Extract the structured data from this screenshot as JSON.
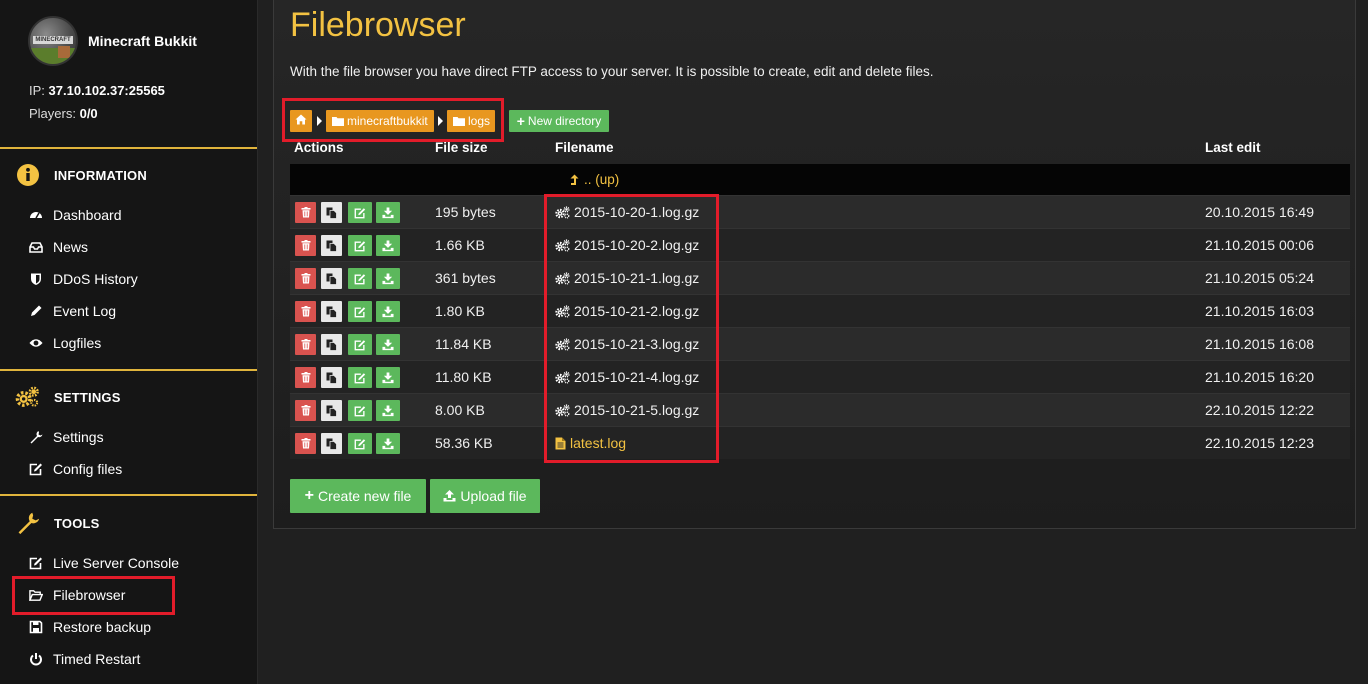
{
  "server": {
    "name": "Minecraft Bukkit",
    "avatar_text": "MINECRAFT",
    "ip_label": "IP:",
    "ip": "37.10.102.37:25565",
    "players_label": "Players:",
    "players": "0/0"
  },
  "sidebar": {
    "sections": [
      {
        "title": "INFORMATION",
        "icon": "info-icon",
        "items": [
          {
            "label": "Dashboard",
            "icon": "dashboard-icon"
          },
          {
            "label": "News",
            "icon": "inbox-icon"
          },
          {
            "label": "DDoS History",
            "icon": "shield-icon"
          },
          {
            "label": "Event Log",
            "icon": "pencil-icon"
          },
          {
            "label": "Logfiles",
            "icon": "eye-icon"
          }
        ]
      },
      {
        "title": "SETTINGS",
        "icon": "gears-icon",
        "items": [
          {
            "label": "Settings",
            "icon": "wrench-icon"
          },
          {
            "label": "Config files",
            "icon": "edit-icon"
          }
        ]
      },
      {
        "title": "TOOLS",
        "icon": "wrench-icon",
        "items": [
          {
            "label": "Live Server Console",
            "icon": "edit-icon"
          },
          {
            "label": "Filebrowser",
            "icon": "folder-open-icon"
          },
          {
            "label": "Restore backup",
            "icon": "floppy-icon"
          },
          {
            "label": "Timed Restart",
            "icon": "power-icon"
          }
        ]
      }
    ]
  },
  "main": {
    "title": "Filebrowser",
    "description": "With the file browser you have direct FTP access to your server. It is possible to create, edit and delete files.",
    "breadcrumb": [
      "minecraftbukkit",
      "logs"
    ],
    "new_directory_label": "New directory",
    "columns": {
      "actions": "Actions",
      "size": "File size",
      "filename": "Filename",
      "last_edit": "Last edit"
    },
    "up_label": ".. (up)",
    "files": [
      {
        "size": "195 bytes",
        "name": "2015-10-20-1.log.gz",
        "date": "20.10.2015 16:49",
        "type": "archive"
      },
      {
        "size": "1.66 KB",
        "name": "2015-10-20-2.log.gz",
        "date": "21.10.2015 00:06",
        "type": "archive"
      },
      {
        "size": "361 bytes",
        "name": "2015-10-21-1.log.gz",
        "date": "21.10.2015 05:24",
        "type": "archive"
      },
      {
        "size": "1.80 KB",
        "name": "2015-10-21-2.log.gz",
        "date": "21.10.2015 16:03",
        "type": "archive"
      },
      {
        "size": "11.84 KB",
        "name": "2015-10-21-3.log.gz",
        "date": "21.10.2015 16:08",
        "type": "archive"
      },
      {
        "size": "11.80 KB",
        "name": "2015-10-21-4.log.gz",
        "date": "21.10.2015 16:20",
        "type": "archive"
      },
      {
        "size": "8.00 KB",
        "name": "2015-10-21-5.log.gz",
        "date": "22.10.2015 12:22",
        "type": "archive"
      },
      {
        "size": "58.36 KB",
        "name": "latest.log",
        "date": "22.10.2015 12:23",
        "type": "text"
      }
    ],
    "create_file_label": "Create new file",
    "upload_file_label": "Upload file"
  },
  "colors": {
    "accent_yellow": "#f3c242",
    "breadcrumb_orange": "#e8971f",
    "success_green": "#5cb85c",
    "danger_red": "#d9534f",
    "highlight_red": "#e21c2a"
  }
}
